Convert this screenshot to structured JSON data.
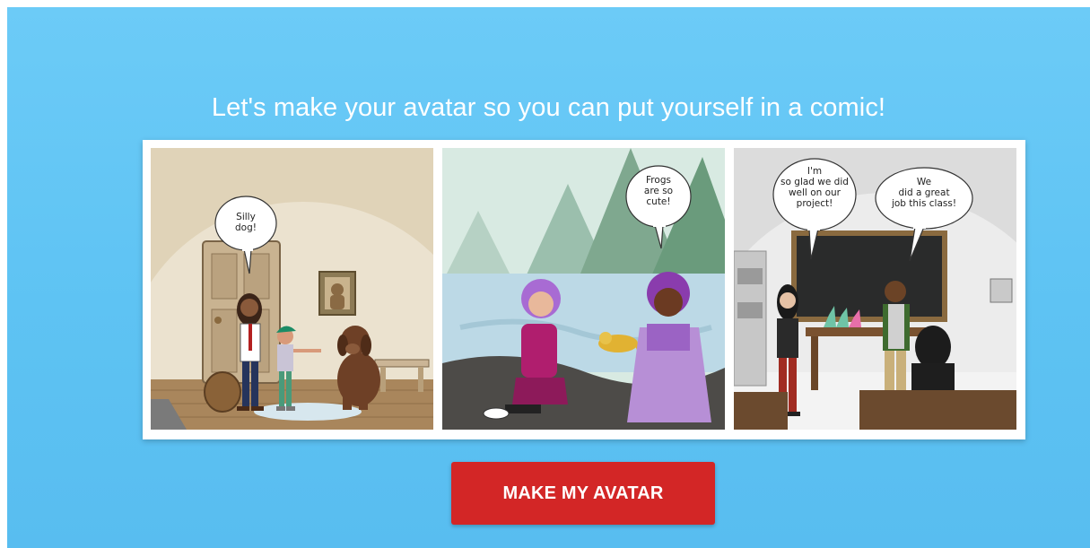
{
  "hero": {
    "headline": "Let's make your avatar so you can put yourself in a comic!"
  },
  "comic": {
    "panels": [
      {
        "scene": "house-with-dog",
        "bubbles": [
          "Silly\ndog!"
        ]
      },
      {
        "scene": "lake-with-frog",
        "bubbles": [
          "Frogs\nare so\ncute!"
        ]
      },
      {
        "scene": "classroom",
        "bubbles": [
          "I'm\nso glad we did\nwell on our\nproject!",
          "We\ndid a great\njob this class!"
        ]
      }
    ]
  },
  "cta": {
    "label": "MAKE MY AVATAR",
    "color": "#d32626"
  },
  "colors": {
    "background": "#62c5f4",
    "headline": "#ffffff"
  }
}
